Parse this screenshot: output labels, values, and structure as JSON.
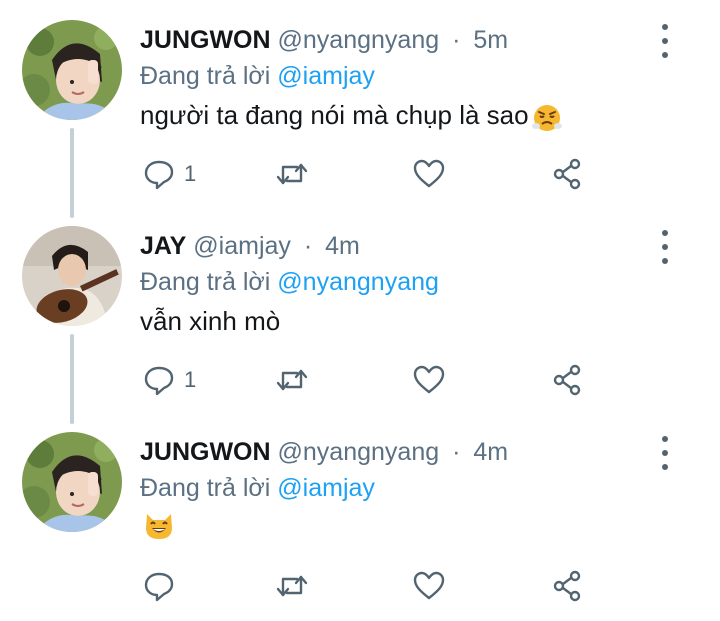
{
  "tweets": [
    {
      "name": "JUNGWON",
      "handle": "@nyangnyang",
      "separator": "·",
      "time": "5m",
      "replying_prefix": "Đang trả lời",
      "replying_to": "@iamjay",
      "text": "người ta đang nói mà chụp là sao",
      "emoji": "steam-face-emoji",
      "reply_count": "1",
      "icons": [
        "reply-icon",
        "retweet-icon",
        "like-icon",
        "share-icon",
        "more-icon"
      ]
    },
    {
      "name": "JAY",
      "handle": "@iamjay",
      "separator": "·",
      "time": "4m",
      "replying_prefix": "Đang trả lời",
      "replying_to": "@nyangnyang",
      "text": "vẫn xinh mò",
      "reply_count": "1",
      "icons": [
        "reply-icon",
        "retweet-icon",
        "like-icon",
        "share-icon",
        "more-icon"
      ]
    },
    {
      "name": "JUNGWON",
      "handle": "@nyangnyang",
      "separator": "·",
      "time": "4m",
      "replying_prefix": "Đang trả lời",
      "replying_to": "@iamjay",
      "emoji": "grinning-cat-emoji",
      "reply_count": "",
      "icons": [
        "reply-icon",
        "retweet-icon",
        "like-icon",
        "share-icon",
        "more-icon"
      ]
    }
  ],
  "colors": {
    "text_primary": "#14171a",
    "text_secondary": "#5b7083",
    "mention": "#1da1f2",
    "thread_line": "#c4cfd6"
  }
}
